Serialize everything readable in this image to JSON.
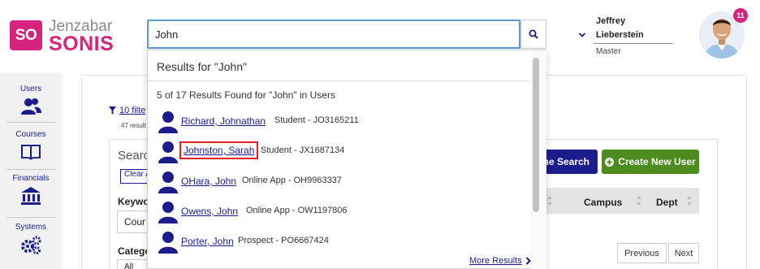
{
  "brand": {
    "logo_mark": "SO",
    "name_top": "Jenzabar",
    "name_bottom": "SONIS"
  },
  "search": {
    "value": "John",
    "button_icon": "search-icon"
  },
  "user": {
    "first_name": "Jeffrey",
    "last_name": "Lieberstein",
    "role": "Master",
    "notification_count": "11"
  },
  "sidebar": {
    "items": [
      {
        "label": "Users",
        "icon": "users-icon"
      },
      {
        "label": "Courses",
        "icon": "book-icon"
      },
      {
        "label": "Financials",
        "icon": "bank-icon"
      },
      {
        "label": "Systems",
        "icon": "gears-icon"
      }
    ]
  },
  "main": {
    "filter_link": "10 filte",
    "result_count": "47 result",
    "search_heading": "Searc",
    "clear_label": "Clear A",
    "keyword_label": "Keywo",
    "keyword_value": "Cour",
    "category_label": "Catego",
    "category_value": "All",
    "home_search_label": "me Search",
    "create_user_label": "Create New User",
    "columns": [
      "Campus",
      "Dept"
    ],
    "previous_label": "Previous",
    "next_label": "Next"
  },
  "dropdown": {
    "title": "Results for \"John\"",
    "count_text": "5 of 17 Results Found for \"John\" in Users",
    "results": [
      {
        "name": "Richard, Johnathan",
        "detail": "Student - JO3165211"
      },
      {
        "name": "Johnston, Sarah",
        "detail": "Student - JX1687134"
      },
      {
        "name": "OHara, John",
        "detail": "Online App - OH9963337"
      },
      {
        "name": "Owens, John",
        "detail": "Online App - OW1197806"
      },
      {
        "name": "Porter, John",
        "detail": "Prospect - PO6667424"
      }
    ],
    "more_label": "More Results"
  },
  "colors": {
    "brand_pink": "#d6247e",
    "nav_blue": "#1c1c8c",
    "create_green": "#4c8c1e",
    "highlight_red": "#e02020"
  }
}
